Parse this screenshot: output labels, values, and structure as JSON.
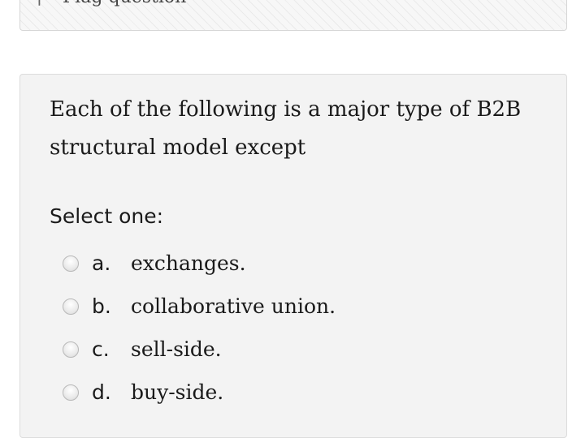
{
  "flag": {
    "label": "Flag question",
    "icon": "flag-icon"
  },
  "question": {
    "text": "Each of the following is a major type of B2B structural model except",
    "select_label": "Select one:",
    "options": [
      {
        "letter": "a.",
        "text": "exchanges."
      },
      {
        "letter": "b.",
        "text": "collaborative union."
      },
      {
        "letter": "c.",
        "text": "sell-side."
      },
      {
        "letter": "d.",
        "text": "buy-side."
      }
    ]
  }
}
